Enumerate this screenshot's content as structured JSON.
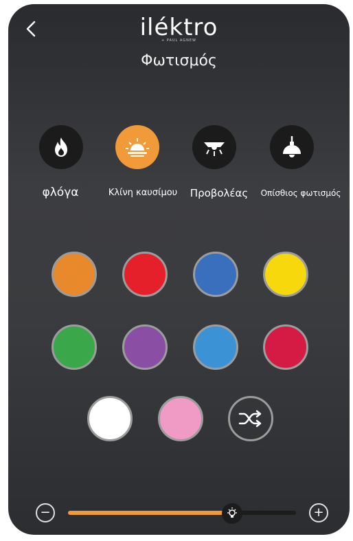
{
  "header": {
    "brand": "iléktro",
    "brand_sub": "+ PAUL AGNEW",
    "title": "Φωτισμός",
    "back_icon": "chevron-left-icon"
  },
  "modes": [
    {
      "label": "φλόγα",
      "icon": "flame-icon",
      "active": false
    },
    {
      "label": "Κλίνη καυσίμου",
      "icon": "sunrise-icon",
      "active": true
    },
    {
      "label": "Προβολέας",
      "icon": "spotlight-icon",
      "active": false
    },
    {
      "label": "Οπίσθιος φωτισμός",
      "icon": "pendant-lamp-icon",
      "active": false
    }
  ],
  "colors": {
    "row1": [
      "#e8892c",
      "#e5202a",
      "#3a6fbe",
      "#f7d80c"
    ],
    "row2": [
      "#3aa84a",
      "#8a4ea4",
      "#3b93d6",
      "#d51a43"
    ],
    "row3": [
      "#ffffff",
      "#f09ac6"
    ],
    "shuffle_icon": "shuffle-icon"
  },
  "brightness": {
    "level": 0.72,
    "minus_label": "−",
    "plus_label": "+",
    "thumb_icon": "bulb-icon",
    "accent": "#f09a3a"
  }
}
